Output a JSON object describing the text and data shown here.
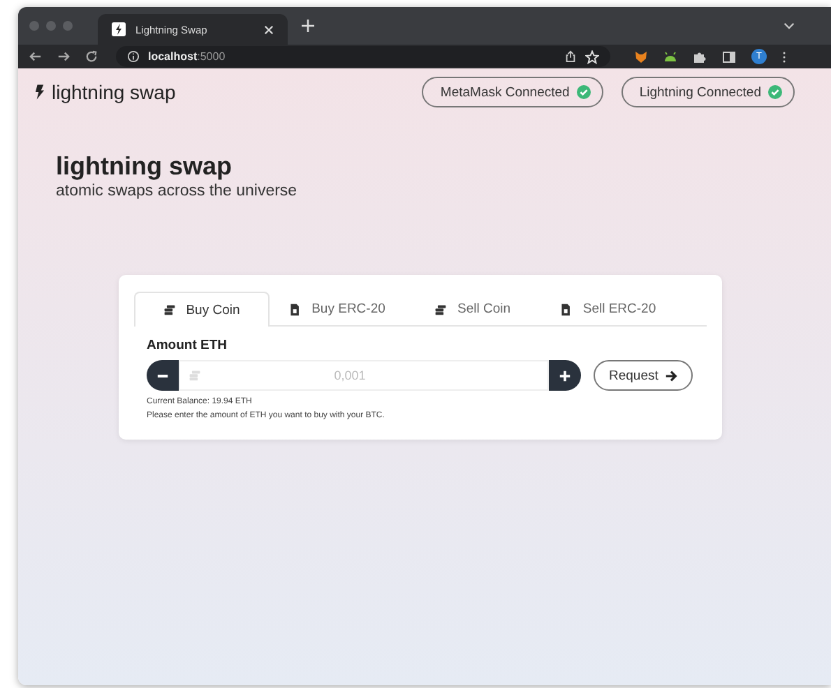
{
  "browser": {
    "tab_title": "Lightning Swap",
    "url_host": "localhost",
    "url_port": ":5000",
    "profile_initial": "T"
  },
  "header": {
    "brand": "lightning swap",
    "status_badges": [
      {
        "label": "MetaMask Connected",
        "connected": true
      },
      {
        "label": "Lightning Connected",
        "connected": true
      }
    ]
  },
  "hero": {
    "title": "lightning swap",
    "subtitle": "atomic swaps across the universe"
  },
  "swap_card": {
    "tabs": [
      {
        "label": "Buy Coin",
        "kind": "coin",
        "selected": true
      },
      {
        "label": "Buy ERC-20",
        "kind": "token",
        "selected": false
      },
      {
        "label": "Sell Coin",
        "kind": "coin",
        "selected": false
      },
      {
        "label": "Sell ERC-20",
        "kind": "token",
        "selected": false
      }
    ],
    "amount_label": "Amount ETH",
    "amount_field": {
      "placeholder": "0,001"
    },
    "request_button": "Request",
    "balance": "Current Balance: 19.94 ETH",
    "hint": "Please enter the amount of ETH you want to buy with your BTC."
  }
}
